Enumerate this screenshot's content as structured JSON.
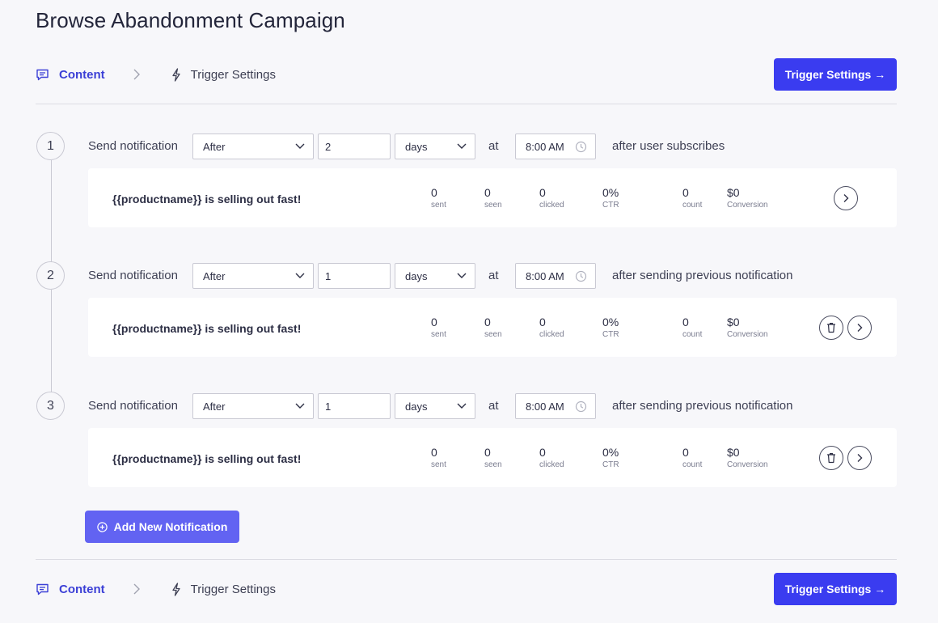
{
  "page": {
    "title": "Browse Abandonment Campaign"
  },
  "nav": {
    "content_label": "Content",
    "trigger_label": "Trigger Settings",
    "next_button": "Trigger Settings →"
  },
  "step_row": {
    "send_label": "Send notification",
    "at_label": "at"
  },
  "steps": [
    {
      "number": "1",
      "timing": "After",
      "amount": "2",
      "unit": "days",
      "time": "8:00 AM",
      "suffix": "after user subscribes",
      "title": "{{productname}} is selling out fast!",
      "stats": {
        "sent": "0",
        "seen": "0",
        "clicked": "0",
        "ctr": "0%",
        "count": "0",
        "conversion": "$0"
      },
      "deletable": false
    },
    {
      "number": "2",
      "timing": "After",
      "amount": "1",
      "unit": "days",
      "time": "8:00 AM",
      "suffix": "after sending previous notification",
      "title": "{{productname}} is selling out fast!",
      "stats": {
        "sent": "0",
        "seen": "0",
        "clicked": "0",
        "ctr": "0%",
        "count": "0",
        "conversion": "$0"
      },
      "deletable": true
    },
    {
      "number": "3",
      "timing": "After",
      "amount": "1",
      "unit": "days",
      "time": "8:00 AM",
      "suffix": "after sending previous notification",
      "title": "{{productname}} is selling out fast!",
      "stats": {
        "sent": "0",
        "seen": "0",
        "clicked": "0",
        "ctr": "0%",
        "count": "0",
        "conversion": "$0"
      },
      "deletable": true
    }
  ],
  "stat_labels": {
    "sent": "sent",
    "seen": "seen",
    "clicked": "clicked",
    "ctr": "CTR",
    "count": "count",
    "conversion": "Conversion"
  },
  "add_button": "Add New Notification",
  "colors": {
    "accent": "#3a3cf0",
    "add_button": "#6263f2",
    "background": "#f7f7fa"
  },
  "icons": [
    "chat-icon",
    "bolt-icon",
    "chevron-right-icon",
    "chevron-down-icon",
    "clock-icon",
    "trash-icon",
    "plus-circle-icon"
  ]
}
